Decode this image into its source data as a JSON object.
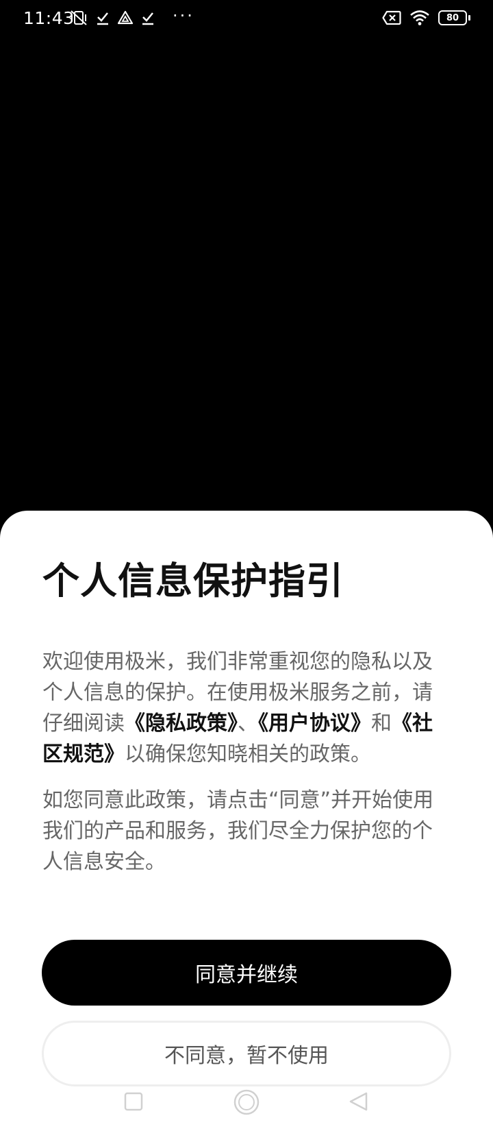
{
  "status_bar": {
    "time": "11:43",
    "icons_left": [
      "vibrate-off-icon",
      "check-icon",
      "drive-icon",
      "check-icon"
    ],
    "overflow": "···",
    "icons_right": [
      "no-sim-icon",
      "wifi-icon",
      "battery-icon"
    ],
    "battery_level": "80"
  },
  "dialog": {
    "title": "个人信息保护指引",
    "para1": {
      "l1": "欢迎使用极米，我们非常重视您的隐私以及",
      "l2": "个人信息的保护。在使用极米服务之前，请",
      "l3_prefix": "仔细阅读",
      "privacy_link": "《隐私政策》",
      "sep": "、",
      "user_link": "《用户协议》",
      "and": "和",
      "community_link_part1": "《社",
      "community_link_part2": "区规范》",
      "l4_suffix": "以确保您知晓相关的政策。"
    },
    "para2": {
      "l1": "如您同意此政策，请点击“同意”并开始使用",
      "l2": "我们的产品和服务，我们尽全力保护您的个",
      "l3": "人信息安全。"
    },
    "agree_button": "同意并继续",
    "disagree_button": "不同意，暂不使用"
  },
  "nav_bar": {
    "buttons": [
      "recents-icon",
      "home-icon",
      "back-icon"
    ]
  },
  "colors": {
    "background": "#000000",
    "sheet": "#ffffff",
    "title": "#111111",
    "body_text": "#666666",
    "primary_button": "#000000",
    "secondary_border": "#eeeeee"
  }
}
